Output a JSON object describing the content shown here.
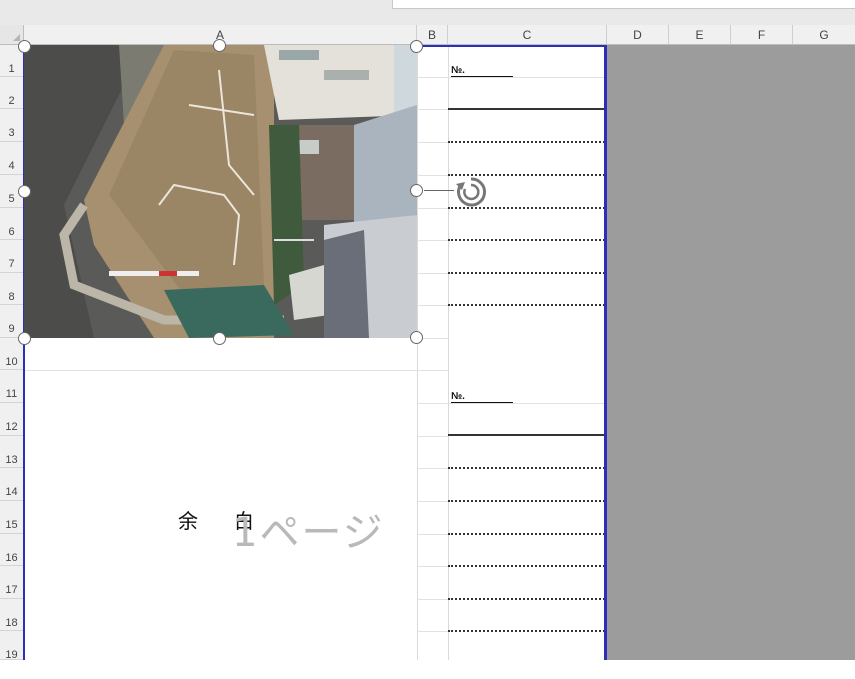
{
  "columns": [
    {
      "id": "col-a",
      "label": "A"
    },
    {
      "id": "col-b",
      "label": "B"
    },
    {
      "id": "col-c",
      "label": "C"
    },
    {
      "id": "col-d",
      "label": "D"
    },
    {
      "id": "col-e",
      "label": "E"
    },
    {
      "id": "col-f",
      "label": "F"
    },
    {
      "id": "col-g",
      "label": "G"
    }
  ],
  "rows": [
    "1",
    "2",
    "3",
    "4",
    "5",
    "6",
    "7",
    "8",
    "9",
    "10",
    "11",
    "12",
    "13",
    "14",
    "15",
    "16",
    "17",
    "18",
    "19"
  ],
  "sheet": {
    "no_label_1": "№.",
    "no_label_2": "№.",
    "watermark_amaki": "余白",
    "watermark_page": "1ページ"
  },
  "colors": {
    "page_break": "#2d2fb8",
    "outside_print_area": "#9c9c9c",
    "header_bg": "#f0f0f0"
  }
}
